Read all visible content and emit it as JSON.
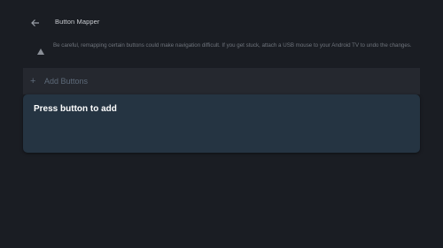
{
  "header": {
    "back_icon": "arrow-left-icon",
    "title": "Button Mapper"
  },
  "warning": {
    "icon": "warning-triangle-icon",
    "text": "Be careful, remapping certain buttons could make navigation difficult. If you get stuck, attach a USB mouse to your Android TV to undo the changes."
  },
  "add_buttons": {
    "icon": "plus-icon",
    "label": "Add Buttons"
  },
  "dialog": {
    "message": "Press button to add"
  },
  "colors": {
    "background": "#1a1d23",
    "dialog": "#253442",
    "add_row": "#25282f",
    "muted_text": "#6f747c",
    "accent_dim": "#5d6a79"
  }
}
